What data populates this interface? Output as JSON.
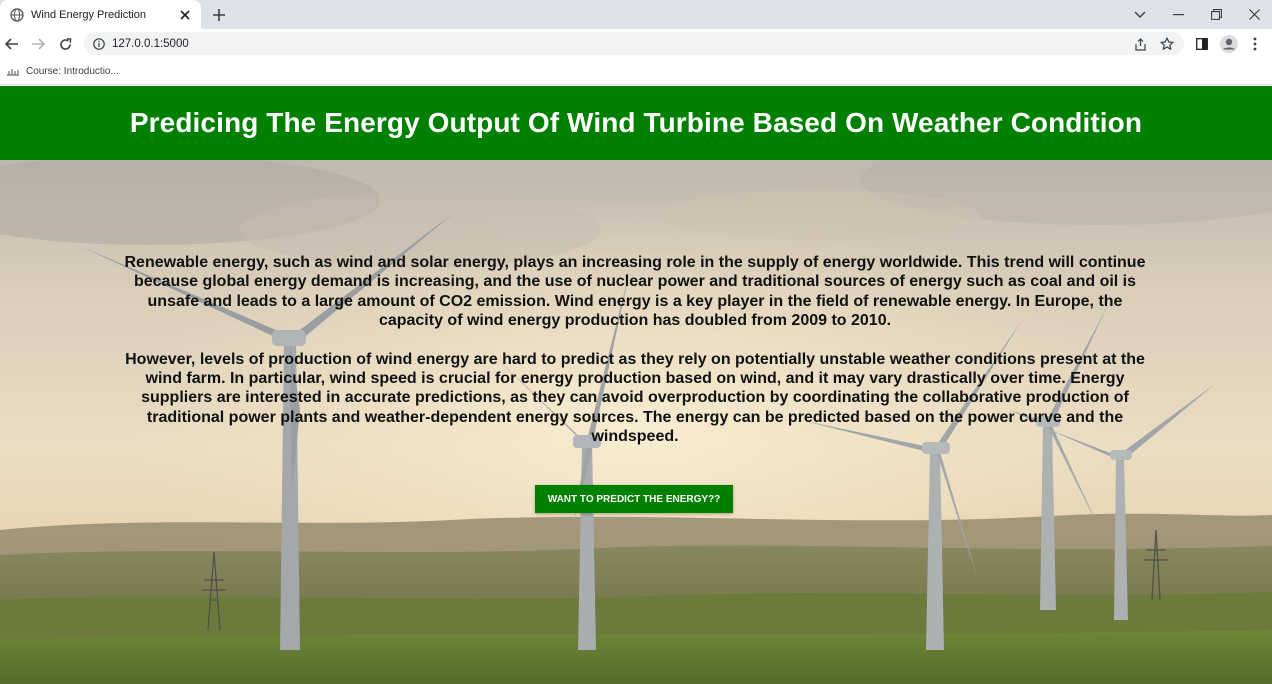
{
  "browser": {
    "tab_title": "Wind Energy Prediction",
    "url": "127.0.0.1:5000",
    "bookmark_label": "Course: Introductio..."
  },
  "page": {
    "title": "Predicing The Energy Output Of Wind Turbine Based On Weather Condition",
    "paragraphs": [
      "Renewable energy, such as wind and solar energy, plays an increasing role in the supply of energy worldwide. This trend will continue because global energy demand is increasing, and the use of nuclear power and traditional sources of energy such as coal and oil is unsafe and leads to a large amount of CO2 emission. Wind energy is a key player in the field of renewable energy. In Europe, the capacity of wind energy production has doubled from 2009 to 2010.",
      "However, levels of production of wind energy are hard to predict as they rely on potentially unstable weather conditions present at the wind farm. In particular, wind speed is crucial for energy production based on wind, and it may vary drastically over time. Energy suppliers are interested in accurate predictions, as they can avoid overproduction by coordinating the collaborative production of traditional power plants and weather-dependent energy sources. The energy can be predicted based on the power curve and the windspeed."
    ],
    "predict_button": "WANT TO PREDICT THE ENERGY??"
  },
  "colors": {
    "header_bg": "#008000",
    "button_bg": "#008000",
    "tabbar_bg": "#dee1e6"
  }
}
